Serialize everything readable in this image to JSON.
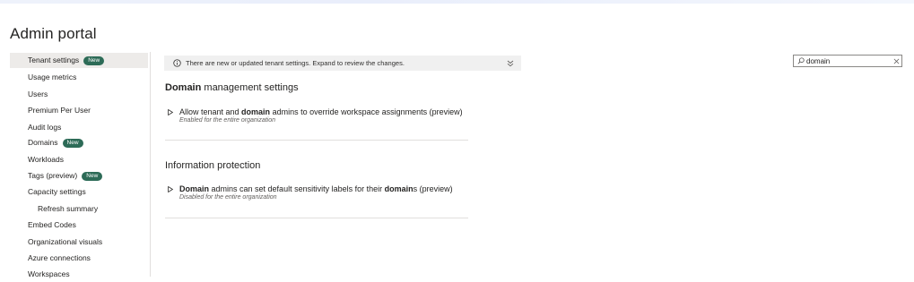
{
  "page": {
    "title": "Admin portal"
  },
  "sidebar": {
    "items": [
      {
        "label": "Tenant settings",
        "badge": "New",
        "selected": true
      },
      {
        "label": "Usage metrics"
      },
      {
        "label": "Users"
      },
      {
        "label": "Premium Per User"
      },
      {
        "label": "Audit logs"
      },
      {
        "label": "Domains",
        "badge": "New"
      },
      {
        "label": "Workloads"
      },
      {
        "label": "Tags (preview)",
        "badge": "New"
      },
      {
        "label": "Capacity settings"
      },
      {
        "label": "Refresh summary",
        "sub": true
      },
      {
        "label": "Embed Codes"
      },
      {
        "label": "Organizational visuals"
      },
      {
        "label": "Azure connections"
      },
      {
        "label": "Workspaces"
      }
    ]
  },
  "notice": {
    "text": "There are new or updated tenant settings. Expand to review the changes.",
    "icon": "info-icon",
    "expand_icon": "chevron-down-icon"
  },
  "search": {
    "value": "domain",
    "icon": "search-icon",
    "clear_icon": "close-icon"
  },
  "sections": [
    {
      "heading_bold": "Domain",
      "heading_rest": " management settings",
      "setting": {
        "title_pre": "Allow tenant and ",
        "title_bold": "domain",
        "title_post": " admins to override workspace assignments (preview)",
        "status": "Enabled for the entire organization"
      }
    },
    {
      "heading": "Information protection",
      "setting": {
        "title_bold": "Domain",
        "title_mid": " admins can set default sensitivity labels for their ",
        "title_bold2": "domain",
        "title_post": "s (preview)",
        "status": "Disabled for the entire organization"
      }
    }
  ],
  "colors": {
    "badge": "#2d6b57",
    "selected": "#edebe9",
    "notice_bg": "#f0f0f0",
    "divider": "#e1dfdd"
  }
}
